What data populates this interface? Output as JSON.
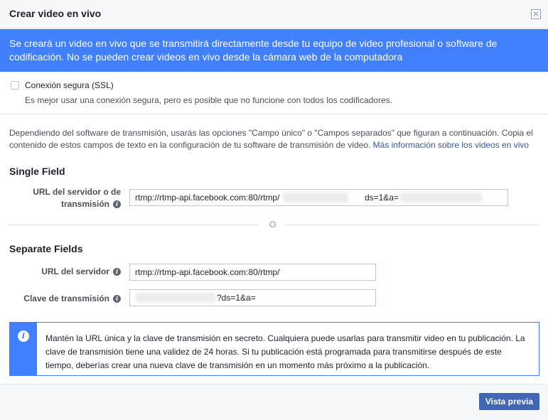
{
  "header": {
    "title": "Crear video en vivo",
    "close_icon": "close-icon"
  },
  "banner": {
    "text": "Se creará un video en vivo que se transmitirá directamente desde tu equipo de video profesional o software de codificación. No se pueden crear videos en vivo desde la cámara web de la computadora"
  },
  "ssl": {
    "label": "Conexión segura (SSL)",
    "hint": "Es mejor usar una conexión segura, pero es posible que no funcione con todos los codificadores.",
    "checked": false
  },
  "info": {
    "text": "Dependiendo del software de transmisión, usarás las opciones \"Campo único\" o \"Campos separados\" que figuran a continuación. Copia el contenido de estos campos de texto en la configuración de tu software de transmisión de video. ",
    "link": "Más información sobre los videos en vivo"
  },
  "single_field": {
    "title": "Single Field",
    "label": "URL del servidor o de transmisión",
    "value_prefix": "rtmp://rtmp-api.facebook.com:80/rtmp/",
    "value_suffix": "ds=1&a="
  },
  "separator": {
    "text": "O"
  },
  "separate_fields": {
    "title": "Separate Fields",
    "server_label": "URL del servidor",
    "server_value": "rtmp://rtmp-api.facebook.com:80/rtmp/",
    "key_label": "Clave de transmisión",
    "key_value_suffix": "?ds=1&a="
  },
  "notice": {
    "icon": "info-icon",
    "text": "Mantén la URL única y la clave de transmisión en secreto. Cualquiera puede usarlas para transmitir video en tu publicación. La clave de transmisión tiene una validez de 24 horas. Si tu publicación está programada para transmitirse después de este tiempo, deberías crear una nueva clave de transmisión en un momento más próximo a la publicación."
  },
  "footer": {
    "preview_label": "Vista previa"
  },
  "colors": {
    "accent": "#4080ff",
    "button": "#4267b2",
    "link": "#365899"
  }
}
